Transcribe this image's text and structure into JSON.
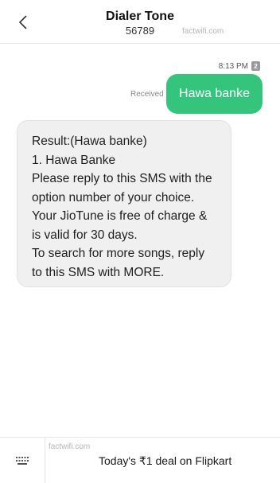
{
  "header": {
    "back_icon": "chevron-left-icon",
    "title": "Dialer Tone",
    "subtitle": "56789",
    "watermark": "factwifi.com"
  },
  "conversation": {
    "time": "8:13 PM",
    "sim_badge": "2",
    "sent_message": {
      "text": "Hawa banke",
      "status": "Received",
      "color": "#34c47c"
    },
    "received_message": {
      "lines": [
        "Result:(Hawa banke)",
        "1. Hawa Banke",
        "Please reply to this SMS with the",
        "option number of your choice.",
        "Your JioTune is free of charge &",
        "is valid for 30 days.",
        "To search for more songs, reply",
        "to this SMS with MORE."
      ]
    }
  },
  "bottom_bar": {
    "keypad_icon": "keypad-icon",
    "watermark": "factwifi.com",
    "promo_text": "Today's ₹1 deal on Flipkart"
  }
}
